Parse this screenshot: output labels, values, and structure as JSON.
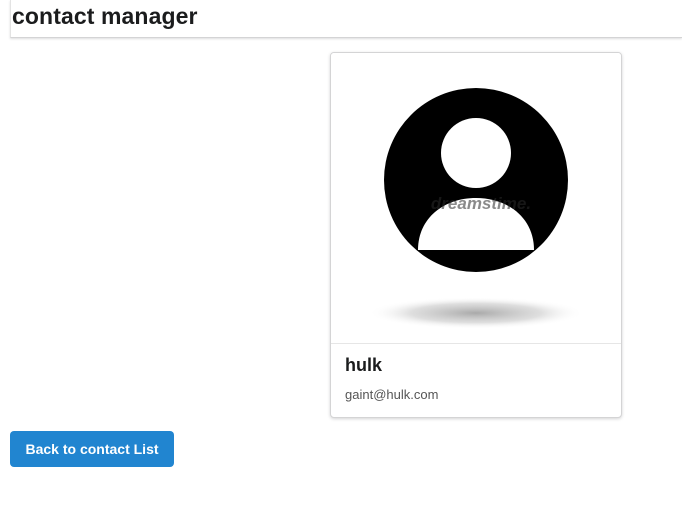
{
  "header": {
    "title": "contact manager"
  },
  "contact": {
    "name": "hulk",
    "email": "gaint@hulk.com",
    "avatar_icon": "user-avatar-icon"
  },
  "actions": {
    "back_label": "Back to contact List"
  },
  "colors": {
    "primary_button": "#2185d0",
    "avatar_fill": "#000000"
  }
}
